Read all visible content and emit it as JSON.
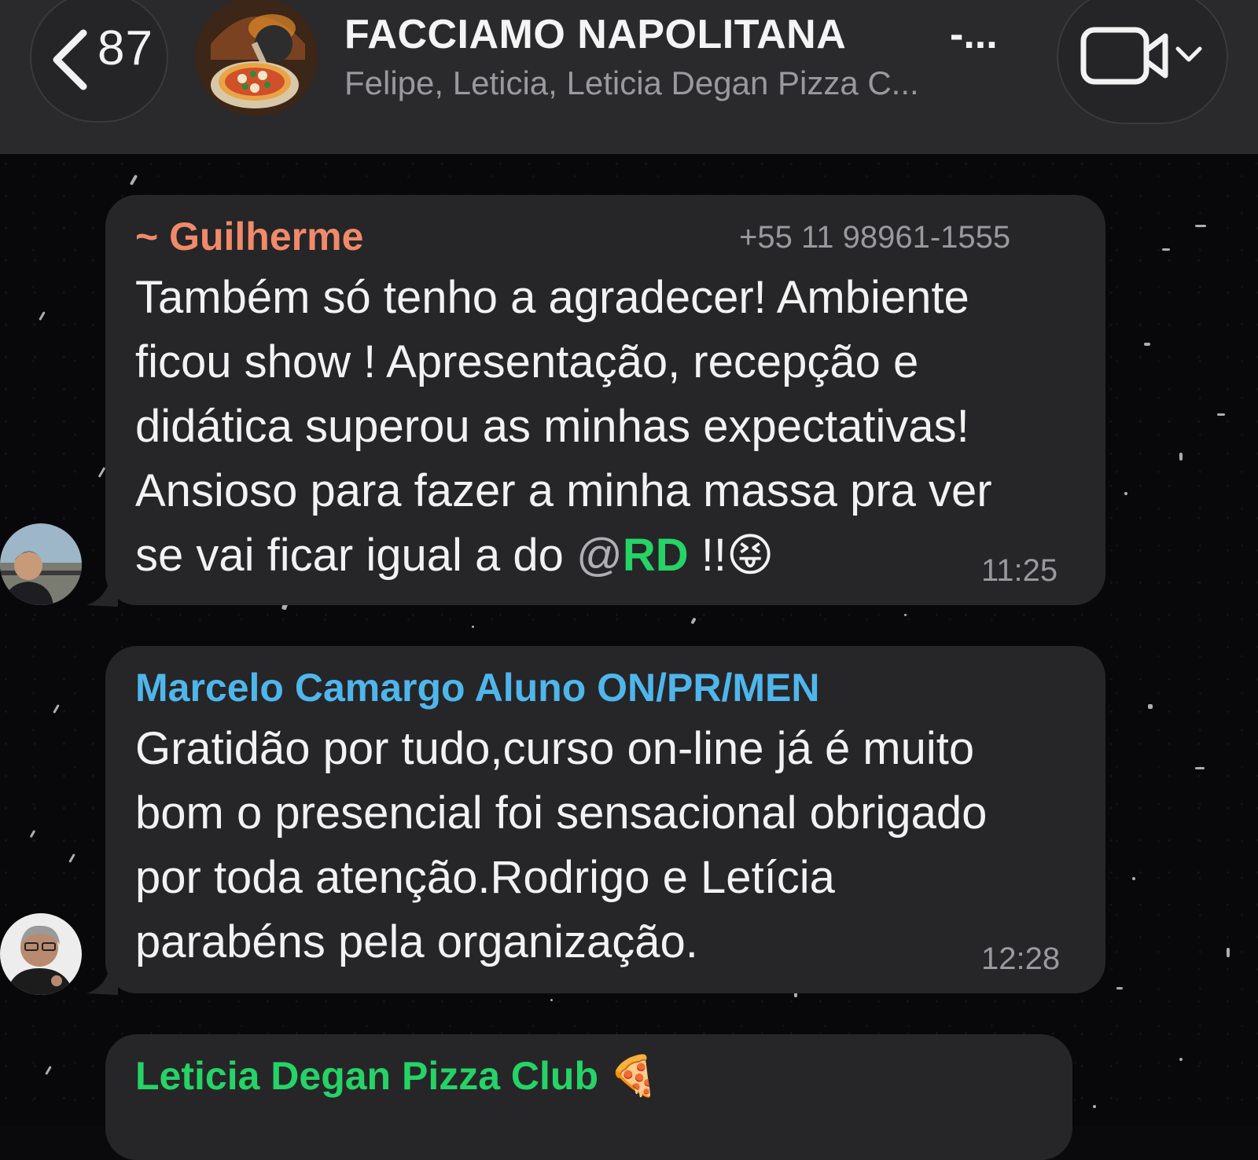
{
  "header": {
    "back_count": "87",
    "title": "FACCIAMO NAPOLITANA",
    "title_ellipsis": "-...",
    "subtitle": "Felipe, Leticia, Leticia Degan Pizza C..."
  },
  "messages": [
    {
      "sender": "~ Guilherme",
      "sender_color": "#f08a6a",
      "phone": "+55 11 98961-1555",
      "lines": [
        "Também só tenho a agradecer!  Ambiente",
        "ficou show ! Apresentação, recepção e",
        "didática superou as minhas expectativas!",
        "Ansioso para fazer a minha massa pra ver"
      ],
      "last_line_prefix": "se vai ficar igual a do ",
      "mention_at": "@",
      "mention_name": "RD",
      "last_line_suffix": " !!",
      "emoji": "😝",
      "time": "11:25"
    },
    {
      "sender": "Marcelo Camargo Aluno ON/PR/MEN",
      "sender_color": "#4fb6ec",
      "lines": [
        "Gratidão por tudo,curso on-line já é muito",
        "bom o presencial foi sensacional obrigado",
        "por toda atenção.Rodrigo e Letícia",
        "parabéns pela organização."
      ],
      "time": "12:28"
    },
    {
      "sender": "Leticia Degan Pizza Club 🍕",
      "sender_color": "#25d366"
    }
  ],
  "colors": {
    "header_bg": "#2a2a2c",
    "bubble_bg": "#262628",
    "chat_bg": "#08080a",
    "mention": "#25d366"
  },
  "icons": {
    "back": "chevron-left-icon",
    "video": "video-camera-icon",
    "dropdown": "chevron-down-icon"
  }
}
